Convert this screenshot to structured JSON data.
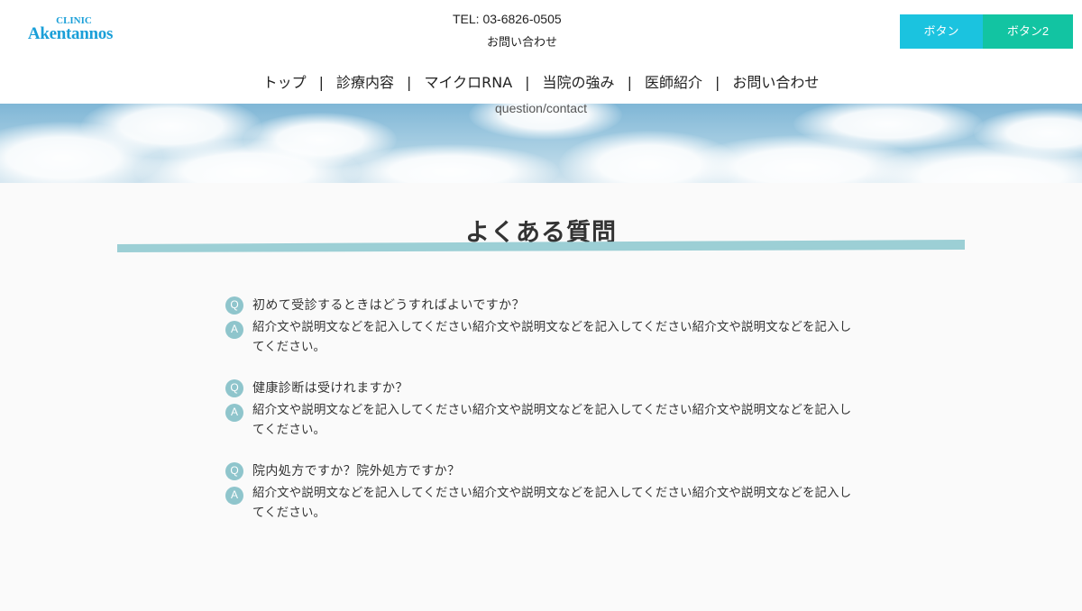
{
  "logo": {
    "small": "CLINIC",
    "main": "Akentannos"
  },
  "header": {
    "tel": "TEL: 03-6826-0505",
    "contact": "お問い合わせ",
    "button1": "ボタン",
    "button2": "ボタン2"
  },
  "nav": {
    "items": [
      "トップ",
      "診療内容",
      "マイクロRNA",
      "当院の強み",
      "医師紹介",
      "お問い合わせ"
    ],
    "separator": "|"
  },
  "hero": {
    "subtitle": "question/contact"
  },
  "faq": {
    "title": "よくある質問",
    "q_badge": "Q",
    "a_badge": "A",
    "items": [
      {
        "q": "初めて受診するときはどうすればよいですか？",
        "a": "紹介文や説明文などを記入してください紹介文や説明文などを記入してください紹介文や説明文などを記入してください。"
      },
      {
        "q": "健康診断は受けれますか？",
        "a": "紹介文や説明文などを記入してください紹介文や説明文などを記入してください紹介文や説明文などを記入してください。"
      },
      {
        "q": "院内処方ですか？院外処方ですか？",
        "a": "紹介文や説明文などを記入してください紹介文や説明文などを記入してください紹介文や説明文などを記入してください。"
      }
    ]
  },
  "colors": {
    "button1": "#1bc3df",
    "button2": "#12c4a2",
    "accent_line": "#9ccfd5",
    "badge": "#8fc5cc",
    "logo": "#1a9fd8"
  }
}
